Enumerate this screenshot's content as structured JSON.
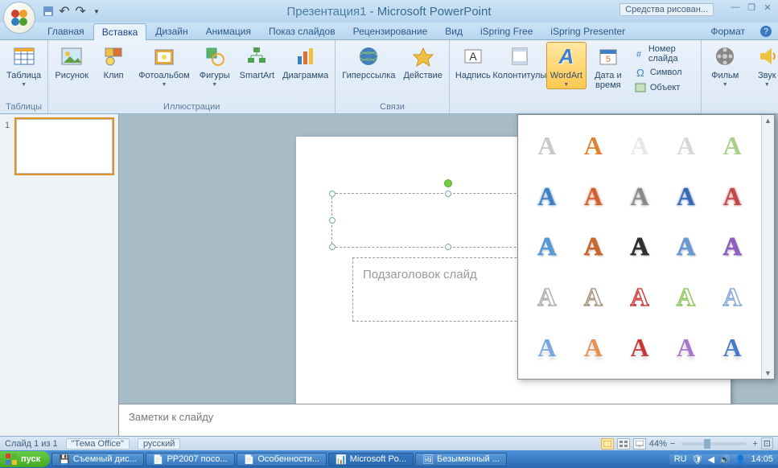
{
  "title": {
    "doc": "Презентация1",
    "sep": " - ",
    "app": "Microsoft PowerPoint"
  },
  "drawing_tools": "Средства рисован...",
  "tabs": [
    "Главная",
    "Вставка",
    "Дизайн",
    "Анимация",
    "Показ слайдов",
    "Рецензирование",
    "Вид",
    "iSpring Free",
    "iSpring Presenter"
  ],
  "tab_format": "Формат",
  "ribbon": {
    "tables": {
      "label": "Таблицы",
      "table": "Таблица"
    },
    "illustrations": {
      "label": "Иллюстрации",
      "picture": "Рисунок",
      "clip": "Клип",
      "album": "Фотоальбом",
      "shapes": "Фигуры",
      "smartart": "SmartArt",
      "chart": "Диаграмма"
    },
    "links": {
      "label": "Связи",
      "hyperlink": "Гиперссылка",
      "action": "Действие"
    },
    "text": {
      "textbox": "Надпись",
      "header_footer": "Колонтитулы",
      "wordart": "WordArt",
      "date_time": "Дата и время",
      "slide_number": "Номер слайда",
      "symbol": "Символ",
      "object": "Объект"
    },
    "media": {
      "movie": "Фильм",
      "sound": "Звук"
    }
  },
  "slide": {
    "subtitle_placeholder": "Подзаголовок слайд"
  },
  "notes": "Заметки к слайду",
  "status": {
    "slide": "Слайд 1 из 1",
    "theme": "\"Тема Office\"",
    "lang": "русский",
    "zoom": "44%"
  },
  "taskbar": {
    "start": "пуск",
    "items": [
      "Съемный дис...",
      "PP2007 посо...",
      "Особенности...",
      "Microsoft Po...",
      "Безымянный ..."
    ],
    "lang": "RU",
    "time": "14:05"
  },
  "wordart_colors": [
    [
      "#c8c8c8",
      "#e08030",
      "#e8e8e8",
      "#d8d8d8",
      "#a8d088"
    ],
    [
      "#4080c0",
      "#d06030",
      "#888888",
      "#3868b0",
      "#c04848"
    ],
    [
      "#5898d8",
      "#c86830",
      "#303030",
      "#6898d0",
      "#9060c0"
    ],
    [
      "#b0b0b0",
      "#a89880",
      "#d04040",
      "#90c860",
      "#88a8d8"
    ],
    [
      "#78a8e0",
      "#e89050",
      "#c83838",
      "#a878d0",
      "#4878c8"
    ]
  ]
}
